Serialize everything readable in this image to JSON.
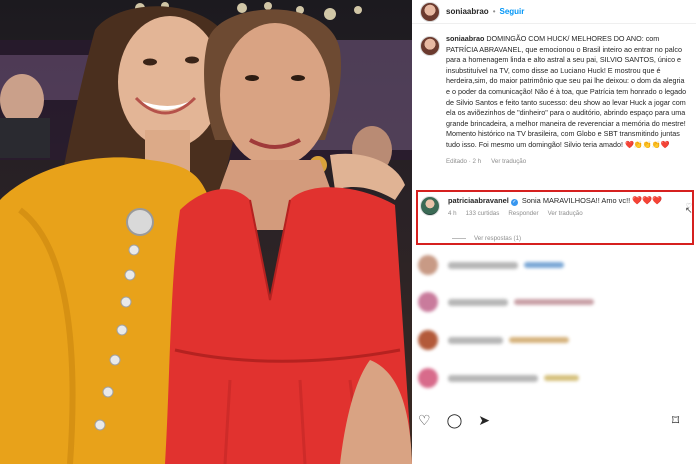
{
  "header": {
    "username": "soniaabrao",
    "separator": "•",
    "follow_label": "Seguir"
  },
  "caption": {
    "username": "soniaabrao",
    "text": " DOMINGÃO COM HUCK/ MELHORES DO ANO: com PATRÍCIA ABRAVANEL, que emocionou o Brasil inteiro ao entrar no palco para a homenagem linda e alto astral a seu pai, SILVIO SANTOS, único e insubstituível na TV, como disse ao Luciano Huck! E mostrou que é herdeira,sim, do maior patrimônio que seu pai lhe deixou: o dom da alegria e o poder da comunicação! Não é à toa, que Patrícia tem honrado o legado de Silvio Santos e feito tanto sucesso: deu show ao levar Huck a jogar com ela os aviõezinhos de \"dinheiro\" para o auditório, abrindo espaço para uma grande brincadeira, a melhor maneira de reverenciar a memória do mestre! Momento histórico na TV brasileira, com Globo e SBT transmitindo juntas tudo isso. Foi mesmo um domingão! Silvio teria amado! ",
    "emojis": "❤️👏👏👏❤️",
    "edited": "Editado · 2 h",
    "see_translation": "Ver tradução"
  },
  "reply": {
    "username": "patriciaabravanel",
    "verified": "✓",
    "text": "Sonia MARAVILHOSA!! Amo vc!!",
    "hearts": "❤️❤️❤️",
    "time": "4 h",
    "likes": "133 curtidas",
    "reply_label": "Responder",
    "see_translation": "Ver tradução",
    "view_replies": "Ver respostas (1)",
    "highlight_color": "#d6201f"
  },
  "icons": {
    "like": "heart-outline-icon",
    "comment": "comment-icon",
    "share": "share-icon",
    "save": "bookmark-icon"
  },
  "colors": {
    "follow": "#0095f6",
    "highlight": "#d6201f",
    "left_dress": "#e8a21a",
    "right_dress": "#e1322f"
  }
}
